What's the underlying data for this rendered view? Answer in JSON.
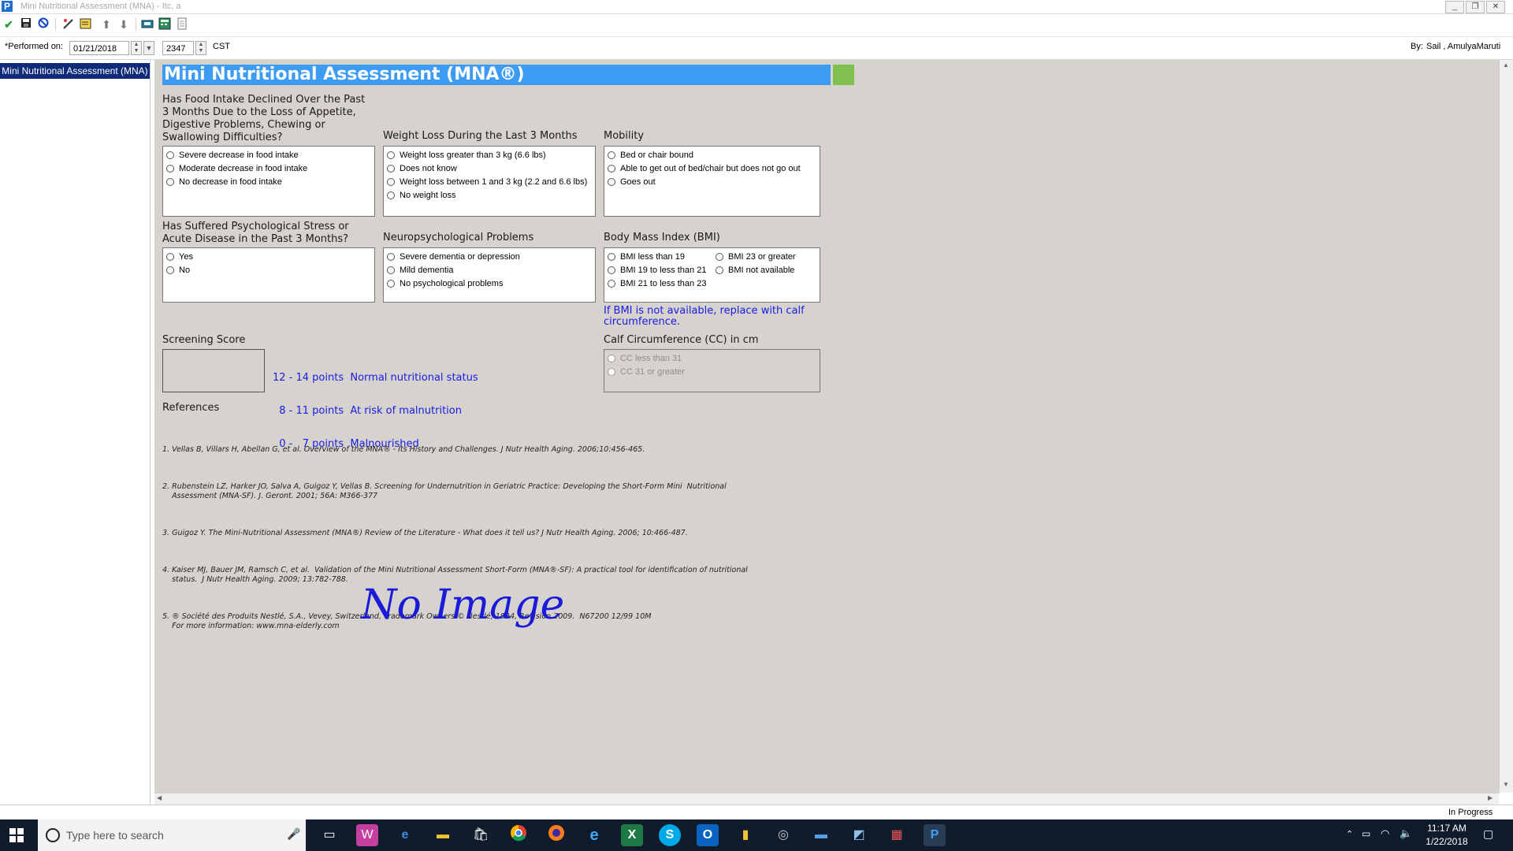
{
  "window": {
    "title": "Mini Nutritional Assessment (MNA) - Itc, a",
    "app_icon_letter": "P",
    "buttons": [
      "minimize",
      "restore",
      "close"
    ]
  },
  "toolbar": {
    "icons": [
      "checkmark-icon",
      "save-icon",
      "cancel-icon",
      "flowsheet-icon",
      "notes-icon",
      "up-arrow-icon",
      "down-arrow-icon",
      "print-icon",
      "calculator-icon",
      "document-icon"
    ]
  },
  "performed": {
    "label": "*Performed on:",
    "date": "01/21/2018",
    "time": "2347",
    "timezone": "CST",
    "by_label": "By:",
    "by_name": "Sail , AmulyaMaruti"
  },
  "sidebar": {
    "items": [
      {
        "label": "Mini Nutritional Assessment (MNA)",
        "selected": true
      }
    ]
  },
  "form": {
    "header": "Mini Nutritional Assessment (MNA®)",
    "accent_color": "#3d9cf2",
    "q_food": {
      "label_lines": [
        "Has Food Intake Declined Over the Past",
        "3 Months Due to the Loss of Appetite,",
        "Digestive Problems, Chewing or",
        "Swallowing Difficulties?"
      ],
      "options": [
        "Severe decrease in food intake",
        "Moderate decrease in food intake",
        "No decrease in food intake"
      ]
    },
    "q_weight": {
      "label": "Weight Loss During the Last 3 Months",
      "options": [
        "Weight loss greater than 3 kg (6.6 lbs)",
        "Does not know",
        "Weight loss between 1 and 3 kg (2.2 and 6.6 lbs)",
        "No weight loss"
      ]
    },
    "q_mobility": {
      "label": "Mobility",
      "options": [
        "Bed or chair bound",
        "Able to get out of bed/chair but does not go out",
        "Goes out"
      ]
    },
    "q_stress": {
      "label_lines": [
        "Has Suffered Psychological Stress or",
        "Acute Disease in the Past 3 Months?"
      ],
      "options": [
        "Yes",
        "No"
      ]
    },
    "q_neuro": {
      "label": "Neuropsychological Problems",
      "options": [
        "Severe dementia or depression",
        "Mild dementia",
        "No psychological problems"
      ]
    },
    "q_bmi": {
      "label": "Body Mass Index (BMI)",
      "options": [
        "BMI less than 19",
        "BMI 19 to less than 21",
        "BMI 21 to less than 23",
        "BMI 23 or greater",
        "BMI not available"
      ],
      "note_lines": [
        "If BMI is not available, replace with calf",
        "circumference."
      ]
    },
    "screening": {
      "label": "Screening Score",
      "legend": [
        "12 - 14 points  Normal nutritional status",
        "  8 - 11 points  At risk of malnutrition",
        "  0 -   7 points  Malnourished"
      ]
    },
    "q_calf": {
      "label": "Calf Circumference (CC) in cm",
      "options": [
        "CC less than 31",
        "CC 31 or greater"
      ],
      "disabled": true
    },
    "references": {
      "label": "References",
      "items": [
        [
          "1. Vellas B, Villars H, Abellan G, et al. Overview of the MNA® - Its History and Challenges. J Nutr Health Aging. 2006;10:456-465."
        ],
        [
          "2. Rubenstein LZ, Harker JO, Salva A, Guigoz Y, Vellas B. Screening for Undernutrition in Geriatric Practice: Developing the Short-Form Mini  Nutritional",
          "    Assessment (MNA-SF). J. Geront. 2001; 56A: M366-377"
        ],
        [
          "3. Guigoz Y. The Mini-Nutritional Assessment (MNA®) Review of the Literature - What does it tell us? J Nutr Health Aging. 2006; 10:466-487."
        ],
        [
          "4. Kaiser MJ, Bauer JM, Ramsch C, et al.  Validation of the Mini Nutritional Assessment Short-Form (MNA®-SF): A practical tool for identification of nutritional",
          "    status.  J Nutr Health Aging. 2009; 13:782-788."
        ],
        [
          "5. ® Société des Produits Nestlé, S.A., Vevey, Switzerland, Trademark Owners © Nestlé, 1994, Revision 2009.  N67200 12/99 10M",
          "    For more information: www.mna-elderly.com"
        ]
      ]
    },
    "handwriting": "No Image"
  },
  "status": {
    "text": "In Progress"
  },
  "taskbar": {
    "search_placeholder": "Type here to search",
    "time": "11:17 AM",
    "date": "1/22/2018",
    "apps": [
      "task-view",
      "app-1",
      "edge",
      "file-explorer",
      "store",
      "chrome",
      "firefox",
      "internet-explorer",
      "excel",
      "skype",
      "outlook",
      "folder",
      "app-2",
      "app-3",
      "app-4",
      "app-5",
      "powerchart"
    ]
  }
}
